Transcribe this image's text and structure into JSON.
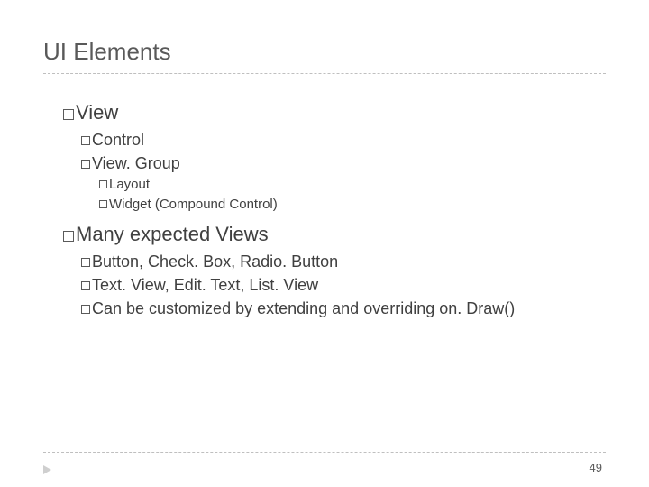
{
  "title": "UI Elements",
  "bullets": {
    "view": "View",
    "control": "Control",
    "viewgroup": "View. Group",
    "layout": "Layout",
    "widget": "Widget (Compound Control)",
    "many": "Many expected Views",
    "button_line": "Button, Check. Box, Radio. Button",
    "text_line": "Text. View, Edit. Text, List. View",
    "can_line": "Can be customized by extending and overriding on. Draw()"
  },
  "page_number": "49"
}
